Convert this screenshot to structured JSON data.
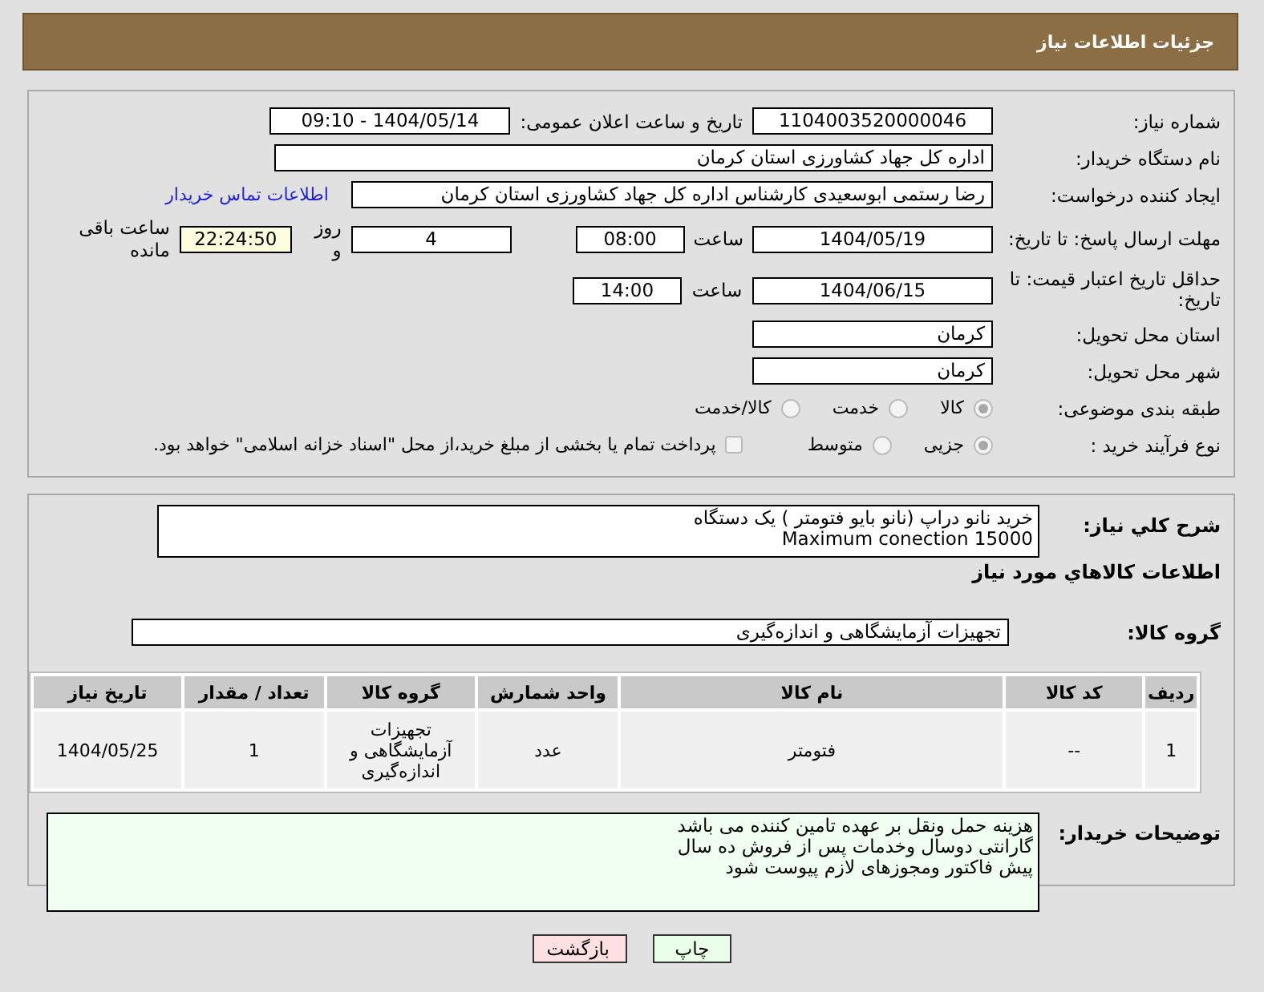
{
  "header": {
    "title": "جزئیات اطلاعات نیاز"
  },
  "need_number": {
    "label": "شماره نیاز:",
    "value": "1104003520000046"
  },
  "announce": {
    "label": "تاریخ و ساعت اعلان عمومی:",
    "value": "1404/05/14 - 09:10"
  },
  "buyer_org": {
    "label": "نام دستگاه خریدار:",
    "value": "اداره کل جهاد کشاورزی استان کرمان"
  },
  "requester": {
    "label": "ایجاد کننده درخواست:",
    "value": "رضا رستمی ابوسعیدی کارشناس اداره کل جهاد کشاورزی استان کرمان",
    "link": "اطلاعات تماس خریدار"
  },
  "deadline": {
    "label": "مهلت ارسال پاسخ: تا تاریخ:",
    "date": "1404/05/19",
    "time_label": "ساعت",
    "time": "08:00",
    "days": "4",
    "days_label": "روز و",
    "remaining": "22:24:50",
    "remaining_label": "ساعت باقی مانده"
  },
  "validity": {
    "label": "حداقل تاریخ اعتبار قیمت: تا تاریخ:",
    "date": "1404/06/15",
    "time_label": "ساعت",
    "time": "14:00"
  },
  "province": {
    "label": "استان محل تحویل:",
    "value": "کرمان"
  },
  "city": {
    "label": "شهر محل تحویل:",
    "value": "کرمان"
  },
  "category": {
    "label": "طبقه بندی موضوعی:",
    "options": [
      {
        "label": "کالا",
        "selected": true
      },
      {
        "label": "خدمت",
        "selected": false
      },
      {
        "label": "کالا/خدمت",
        "selected": false
      }
    ]
  },
  "process": {
    "label": "نوع فرآیند خرید :",
    "options": [
      {
        "label": "جزیی",
        "selected": true
      },
      {
        "label": "متوسط",
        "selected": false
      }
    ],
    "payment": {
      "label": "پرداخت تمام یا بخشی از مبلغ خرید،از محل \"اسناد خزانه اسلامی\" خواهد بود.",
      "checked": false
    }
  },
  "description": {
    "label": "شرح کلي نیاز:",
    "lines": [
      "خرید نانو دراپ (نانو بایو فتومتر ) یک دستگاه",
      "Maximum conection 15000"
    ]
  },
  "goods_heading": "اطلاعات کالاهاي مورد نیاز",
  "goods_group": {
    "label": "گروه کالا:",
    "value": "تجهیزات آزمایشگاهی و اندازه‌گیری"
  },
  "table": {
    "columns": [
      "ردیف",
      "کد کالا",
      "نام کالا",
      "واحد شمارش",
      "گروه کالا",
      "تعداد / مقدار",
      "تاریخ نیاز"
    ],
    "rows": [
      [
        "1",
        "--",
        "فتومتر",
        "عدد",
        "تجهیزات آزمایشگاهی و اندازه‌گیری",
        "1",
        "1404/05/25"
      ]
    ]
  },
  "buyer_notes": {
    "label": "توضیحات خریدار:",
    "lines": [
      "هزینه حمل ونقل بر عهده تامین کننده می باشد",
      "گارانتی دوسال وخدمات پس از فروش ده سال",
      "پیش فاکتور ومجوزهای لازم پیوست شود"
    ]
  },
  "buttons": [
    {
      "label": "چاپ",
      "kind": "print"
    },
    {
      "label": "بازگشت",
      "kind": "back"
    }
  ]
}
